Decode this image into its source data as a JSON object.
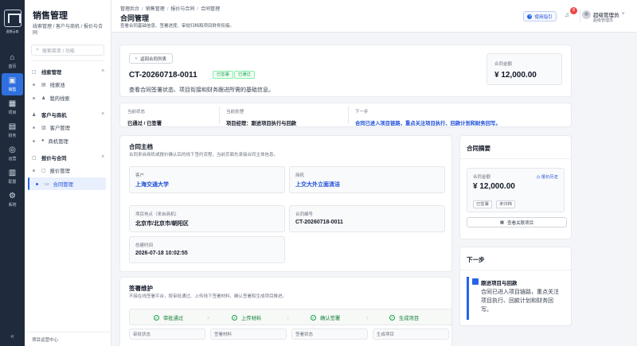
{
  "rail": {
    "logo_text": "速鼎云商",
    "items": [
      {
        "icon": "home-icon",
        "glyph": "⌂",
        "label": "首页"
      },
      {
        "icon": "sales-icon",
        "glyph": "▣",
        "label": "销售"
      },
      {
        "icon": "project-icon",
        "glyph": "▦",
        "label": "项目"
      },
      {
        "icon": "finance-icon",
        "glyph": "▤",
        "label": "财务"
      },
      {
        "icon": "operations-icon",
        "glyph": "◎",
        "label": "运营"
      },
      {
        "icon": "config-icon",
        "glyph": "▥",
        "label": "配置"
      },
      {
        "icon": "system-icon",
        "glyph": "⚙",
        "label": "系统"
      }
    ],
    "active_index": 1,
    "collapse_glyph": "«"
  },
  "sidebar": {
    "title": "销售管理",
    "crumb": "线索管理 / 客户与商机 / 报价与合同",
    "search_placeholder": "搜索菜单 / 功能",
    "groups": [
      {
        "label": "线索管理",
        "items": [
          "线索池",
          "我的线索"
        ]
      },
      {
        "label": "客户与商机",
        "items": [
          "客户管理",
          "商机管理"
        ]
      },
      {
        "label": "报价与合同",
        "items": [
          "报价管理",
          "合同管理"
        ]
      }
    ],
    "footer": "项目运营中心"
  },
  "header": {
    "breadcrumb": [
      "管理后台",
      "销售管理",
      "报价与合同",
      "合同管理"
    ],
    "title": "合同管理",
    "desc": "查看合同基础信息、签署进度、审批归档和项目财务衔接。",
    "help": "使用指引",
    "notif_count": "8",
    "user_name": "超级管理员",
    "user_role": "超级管理员"
  },
  "hero": {
    "back": "返回合同列表",
    "contract_no": "CT-20260718-0011",
    "tag_signed": "已签署",
    "tag_approved": "已通过",
    "desc": "查看合同签署状态、项目衔接和财务跟进所需的基础信息。",
    "amount_label": "合同金额",
    "amount_value": "¥ 12,000.00"
  },
  "status_bar": {
    "current_status_label": "当前状态",
    "current_status_value": "已通过 / 已签署",
    "current_handler_label": "当前处理",
    "current_handler_value": "项目经理：跟进项目执行与回款",
    "next_label": "下一步",
    "next_value": "合同已进入项目链路，重点关注项目执行、回款计划和财务回写。"
  },
  "subject": {
    "title": "合同主档",
    "desc": "合同来自商机或报价确认后的线下签约流程，当前页面先承接合同主体信息。",
    "fields": [
      {
        "label": "客户",
        "value": "上海交通大学",
        "link": true
      },
      {
        "label": "商机",
        "value": "上交大外立面清洁",
        "link": true
      },
      {
        "label": "项目地点（来自商机）",
        "value": "北京市/北京市/朝阳区",
        "link": false
      },
      {
        "label": "合同编号",
        "value": "CT-20260718-0011",
        "link": false
      },
      {
        "label": "创建时间",
        "value": "2026-07-18 10:02:55",
        "link": false
      }
    ]
  },
  "signing": {
    "title": "签署维护",
    "desc": "不接在线签署平台，按审批通过、上传线下签署材料、确认签署和生成项目推进。",
    "steps": [
      "审批通过",
      "上传材料",
      "确认签署",
      "生成项目"
    ],
    "mini_labels": [
      "审批状态",
      "签署材料",
      "签署状态",
      "生成项目"
    ]
  },
  "summary": {
    "title": "合同摘要",
    "amount_label": "合同金额",
    "history": "报价历史",
    "amount_value": "¥ 12,000.00",
    "tag_signed": "已签署",
    "tag_not_archived": "未归档",
    "related_btn": "查看关联项目"
  },
  "next_step": {
    "title": "下一步",
    "item_title": "跟进项目与回款",
    "item_desc": "合同已进入项目链路，重点关注项目执行、回款计划和财务回写。"
  },
  "colors": {
    "accent": "#2563eb",
    "rail_bg": "#1f2a3c",
    "success": "#16a34a",
    "danger": "#ef4444"
  }
}
